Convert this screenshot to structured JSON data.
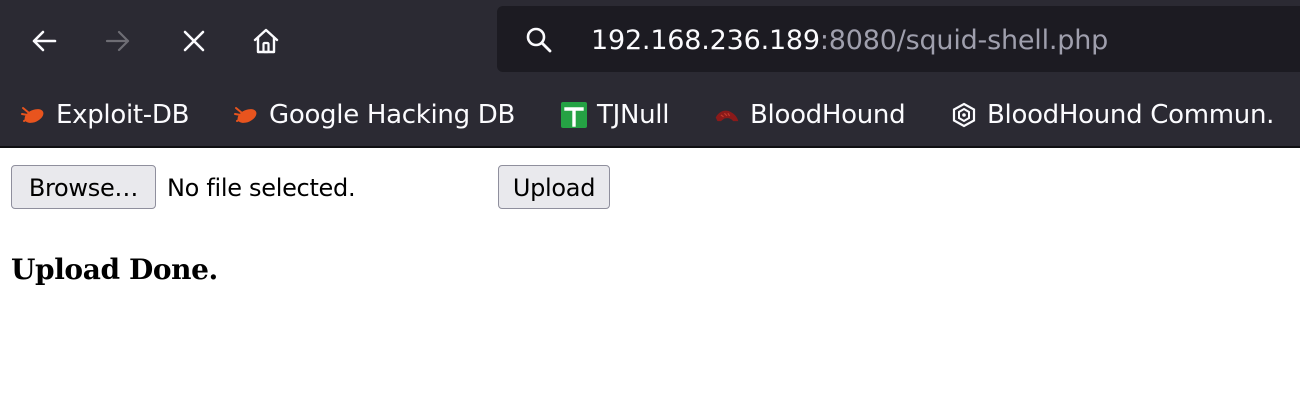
{
  "browser": {
    "url_host": "192.168.236.189",
    "url_rest": ":8080/squid-shell.php",
    "icons": {
      "back": "arrow-left-icon",
      "forward": "arrow-right-icon",
      "stop": "close-icon",
      "home": "home-icon",
      "search": "search-icon"
    },
    "forward_enabled": false
  },
  "bookmarks": [
    {
      "label": "Exploit-DB",
      "icon": "exploit-db-icon",
      "color": "#e8541e"
    },
    {
      "label": "Google Hacking DB",
      "icon": "exploit-db-icon",
      "color": "#e8541e"
    },
    {
      "label": "TJNull",
      "icon": "tjnull-icon",
      "color": "#25a244"
    },
    {
      "label": "BloodHound",
      "icon": "bloodhound-icon",
      "color": "#8b1a1a"
    },
    {
      "label": "BloodHound Commun.",
      "icon": "bloodhound-community-icon",
      "color": "#fbfbfe"
    }
  ],
  "page": {
    "browse_button": "Browse…",
    "file_status": "No file selected.",
    "upload_button": "Upload",
    "message": "Upload Done."
  },
  "colors": {
    "toolbar": "#2b2a33",
    "urlbar": "#1c1b22",
    "url_host": "#fbfbfe",
    "url_rest": "#9f9fad"
  }
}
